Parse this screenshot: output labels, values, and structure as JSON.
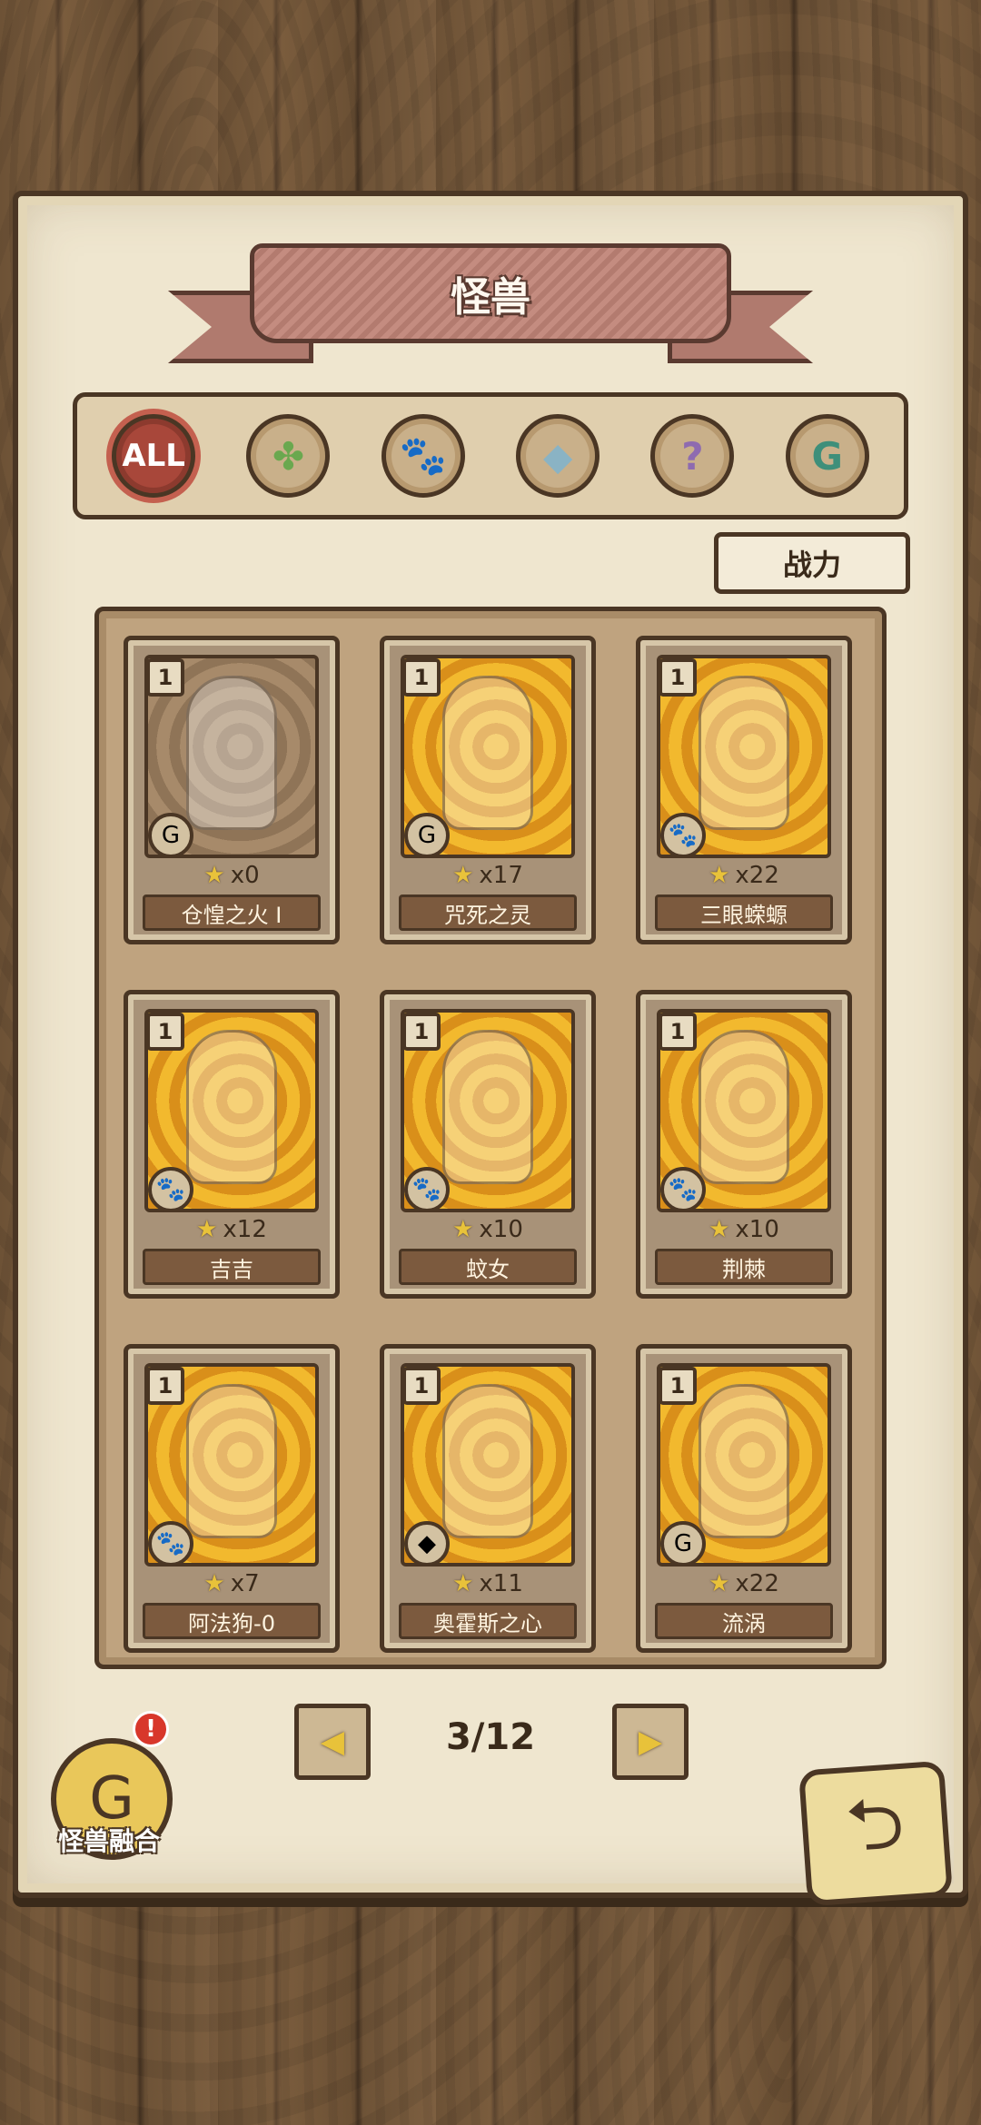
{
  "header": {
    "title": "怪兽"
  },
  "filters": [
    {
      "id": "all",
      "label": "ALL",
      "icon": "all-icon",
      "active": true
    },
    {
      "id": "plant",
      "label": "",
      "icon": "leaf-icon",
      "glyph": "✤",
      "active": false
    },
    {
      "id": "beast",
      "label": "",
      "icon": "paw-icon",
      "glyph": "🐾",
      "active": false
    },
    {
      "id": "crystal",
      "label": "",
      "icon": "crystal-icon",
      "glyph": "◆",
      "active": false
    },
    {
      "id": "mystery",
      "label": "",
      "icon": "question-icon",
      "glyph": "?",
      "active": false
    },
    {
      "id": "spirit",
      "label": "",
      "icon": "swirl-icon",
      "glyph": "G",
      "active": false
    }
  ],
  "sort": {
    "label": "战力"
  },
  "cards": [
    {
      "level": "1",
      "count": "x0",
      "name": "仓惶之火 I",
      "type_icon": "swirl-icon",
      "type_glyph": "G",
      "art": "brown"
    },
    {
      "level": "1",
      "count": "x17",
      "name": "咒死之灵",
      "type_icon": "swirl-icon",
      "type_glyph": "G",
      "art": "gold"
    },
    {
      "level": "1",
      "count": "x22",
      "name": "三眼蝾螈",
      "type_icon": "paw-icon",
      "type_glyph": "🐾",
      "art": "gold"
    },
    {
      "level": "1",
      "count": "x12",
      "name": "吉吉",
      "type_icon": "paw-icon",
      "type_glyph": "🐾",
      "art": "gold"
    },
    {
      "level": "1",
      "count": "x10",
      "name": "蚊女",
      "type_icon": "paw-icon",
      "type_glyph": "🐾",
      "art": "gold"
    },
    {
      "level": "1",
      "count": "x10",
      "name": "荆棘",
      "type_icon": "paw-icon",
      "type_glyph": "🐾",
      "art": "gold"
    },
    {
      "level": "1",
      "count": "x7",
      "name": "阿法狗-0",
      "type_icon": "paw-icon",
      "type_glyph": "🐾",
      "art": "gold"
    },
    {
      "level": "1",
      "count": "x11",
      "name": "奥霍斯之心",
      "type_icon": "crystal-icon",
      "type_glyph": "◆",
      "art": "gold"
    },
    {
      "level": "1",
      "count": "x22",
      "name": "流涡",
      "type_icon": "swirl-icon",
      "type_glyph": "G",
      "art": "gold"
    }
  ],
  "pagination": {
    "label": "3/12",
    "prev_glyph": "◀",
    "next_glyph": "▶"
  },
  "fusion": {
    "label": "怪兽融合",
    "badge": "!",
    "glyph": "G"
  },
  "back": {
    "glyph": "⮌"
  },
  "colors": {
    "panel": "#efe6cf",
    "ribbon": "#c48c80",
    "active_filter": "#a8473a",
    "card_gold": "#f2b92e"
  }
}
